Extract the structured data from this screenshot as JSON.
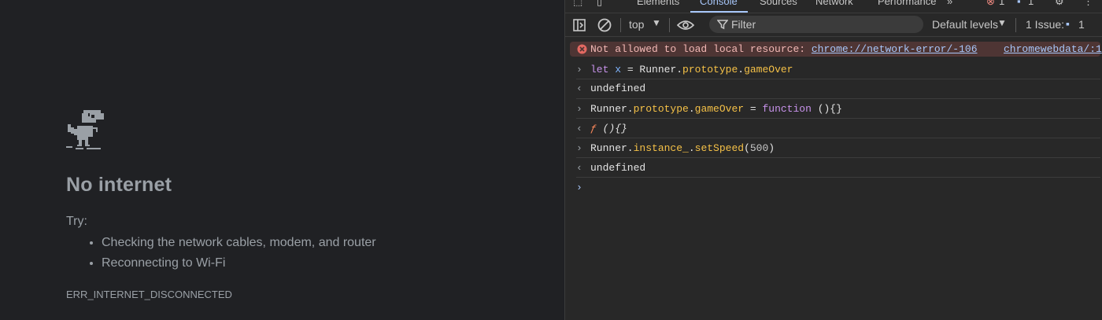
{
  "page": {
    "title": "No internet",
    "try_label": "Try:",
    "suggestions": [
      "Checking the network cables, modem, and router",
      "Reconnecting to Wi-Fi"
    ],
    "error_code": "ERR_INTERNET_DISCONNECTED",
    "dino_icon": "t-rex-icon"
  },
  "devtools": {
    "tabs": [
      "Elements",
      "Console",
      "Sources",
      "Network",
      "Performance"
    ],
    "active_tab": "Console",
    "more_tabs_icon": "chevron-double-right-icon",
    "error_badge_count": "1",
    "message_badge_count": "1",
    "toolbar": {
      "context": "top",
      "filter_placeholder": "Filter",
      "levels": "Default levels",
      "issues_label": "1 Issue:",
      "issues_count": "1"
    },
    "console": {
      "error": {
        "text": "Not allowed to load local resource:",
        "url": "chrome://network-error/-106",
        "source": "chromewebdata/:1"
      },
      "lines": {
        "l1_kw": "let",
        "l1_var": "x",
        "l1_eq": " = Runner.",
        "l1_prop1": "prototype",
        "l1_dot": ".",
        "l1_prop2": "gameOver",
        "r1": "undefined",
        "l2_a": "Runner.",
        "l2_prop1": "prototype",
        "l2_dot": ".",
        "l2_prop2": "gameOver",
        "l2_eq": " = ",
        "l2_kw": "function",
        "l2_rest": " (){}",
        "r2_f": "ƒ",
        "r2_rest": " (){}",
        "l3_a": "Runner.",
        "l3_prop1": "instance_",
        "l3_dot": ".",
        "l3_prop2": "setSpeed",
        "l3_open": "(",
        "l3_num": "500",
        "l3_close": ")",
        "r3": "undefined"
      }
    },
    "colors": {
      "accent": "#a8c7fa",
      "error_bg": "#4e3534",
      "keyword": "#c792ea",
      "property": "#f5c147"
    }
  }
}
